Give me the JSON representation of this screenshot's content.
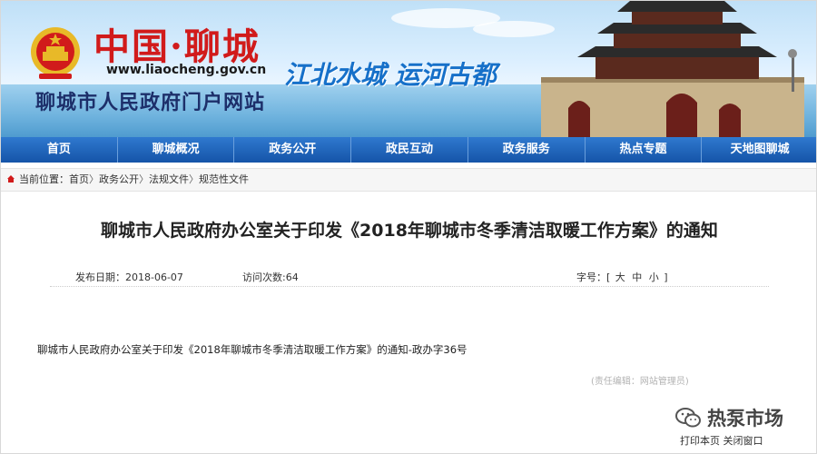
{
  "header": {
    "logo_name": "中国·聊城",
    "logo_url": "www.liaocheng.gov.cn",
    "site_title": "聊城市人民政府门户网站",
    "slogan": "江北水城 运河古都",
    "accent_red": "#d11b1b",
    "accent_blue": "#1d2f6a"
  },
  "nav": {
    "items": [
      "首页",
      "聊城概况",
      "政务公开",
      "政民互动",
      "政务服务",
      "热点专题",
      "天地图聊城"
    ],
    "bg": "#1f65bd"
  },
  "breadcrumb": {
    "prefix": "当前位置：",
    "items": [
      "首页",
      "政务公开",
      "法规文件",
      "规范性文件"
    ],
    "sep": "〉"
  },
  "article": {
    "title": "聊城市人民政府办公室关于印发《2018年聊城市冬季清洁取暖工作方案》的通知",
    "date_label": "发布日期：2018-06-07",
    "views_label": "访问次数:64",
    "font_size_label": "字号：[",
    "font_sizes": [
      "大",
      "中",
      "小"
    ],
    "font_size_end": "]",
    "body": "聊城市人民政府办公室关于印发《2018年聊城市冬季清洁取暖工作方案》的通知-政办字36号",
    "editor": "(责任编辑：网站管理员)"
  },
  "footer": {
    "print": "打印本页",
    "close": "关闭窗口"
  },
  "watermark": {
    "text": "热泵市场"
  }
}
